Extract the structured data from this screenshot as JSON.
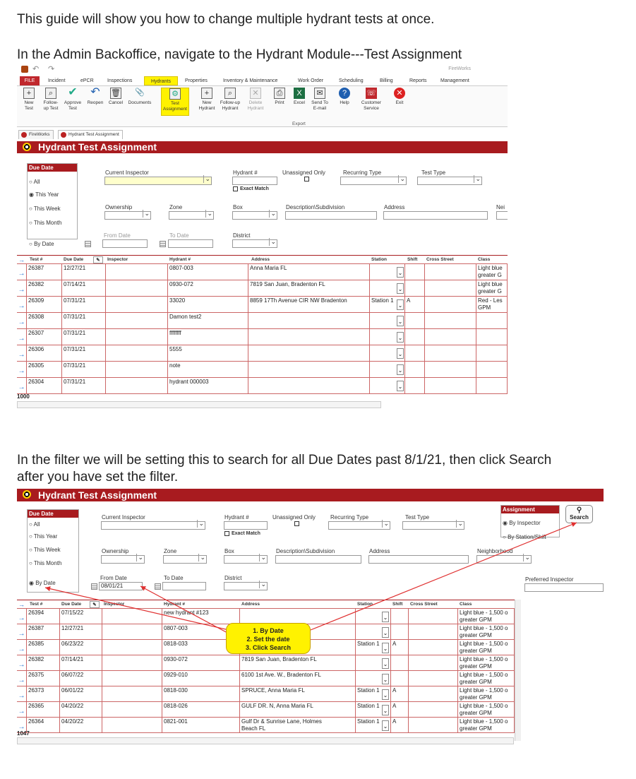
{
  "guide": {
    "intro": "This guide will show you how to change multiple hydrant tests at once.",
    "step1": "In the Admin Backoffice, navigate to the Hydrant Module---Test Assignment",
    "step2_line1": "In the filter we will be setting this to search for all Due Dates past 8/1/21, then click Search",
    "step2_line2": "after you have set the filter."
  },
  "app": {
    "brand": "FireWorks",
    "ribbon_tabs": [
      "FILE",
      "Incident",
      "ePCR",
      "Inspections",
      "Hydrants",
      "Properties",
      "Inventory & Maintenance",
      "Work Order",
      "Scheduling",
      "Billing",
      "Reports",
      "Management"
    ],
    "ribbon_buttons": {
      "new_test": "New\nTest",
      "followup_test": "Follow-\nup Test",
      "approve_test": "Approve\nTest",
      "reopen": "Reopen",
      "cancel": "Cancel",
      "documents": "Documents",
      "test_assignment": "Test\nAssignment",
      "new_hydrant": "New\nHydrant",
      "followup_hydrant": "Follow-up\nHydrant",
      "delete_hydrant": "Delete\nHydrant",
      "print": "Print",
      "excel": "Excel",
      "send_to_email": "Send To\nE-mail",
      "help": "Help",
      "customer_service": "Customer\nService",
      "exit": "Exit"
    },
    "export_group": "Export",
    "doc_tabs": [
      "FireWorks",
      "Hydrant Test Assignment"
    ],
    "window_title": "Hydrant Test Assignment"
  },
  "filters": {
    "due_date_title": "Due Date",
    "due_date_options": [
      "All",
      "This Year",
      "This Week",
      "This Month",
      "By Date"
    ],
    "current_inspector": "Current Inspector",
    "hydrant_num": "Hydrant #",
    "exact_match": "Exact Match",
    "unassigned_only": "Unassigned Only",
    "recurring_type": "Recurring Type",
    "test_type": "Test Type",
    "ownership": "Ownership",
    "zone": "Zone",
    "box": "Box",
    "description_subdivision": "Description\\Subdivision",
    "address": "Address",
    "neighborhood_cut": "Nei",
    "neighborhood": "Neighborhood",
    "from_date": "From Date",
    "to_date": "To Date",
    "district": "District",
    "from_date_value": "08/01/21",
    "assignment_title": "Assignment",
    "assignment_options": [
      "By Inspector",
      "By Station/Shift"
    ],
    "preferred_inspector": "Preferred Inspector",
    "search_label": "Search"
  },
  "grid_columns": [
    "Test #",
    "Due Date",
    "Inspector",
    "Hydrant #",
    "Address",
    "Station",
    "Shift",
    "Cross Street",
    "Class"
  ],
  "grid1": {
    "rows": [
      {
        "test": "26387",
        "due": "12/27/21",
        "hydrant": "0807-003",
        "address": "Anna Maria FL",
        "station": "",
        "shift": "",
        "class": "Light blue\ngreater G"
      },
      {
        "test": "26382",
        "due": "07/14/21",
        "hydrant": "0930-072",
        "address": "7819 San Juan, Bradenton FL",
        "station": "",
        "shift": "",
        "class": "Light blue\ngreater G"
      },
      {
        "test": "26309",
        "due": "07/31/21",
        "hydrant": "33020",
        "address": "8859 17Th Avenue CIR NW Bradenton",
        "station": "Station 1",
        "shift": "A",
        "class": "Red - Les\nGPM"
      },
      {
        "test": "26308",
        "due": "07/31/21",
        "hydrant": "Damon test2",
        "address": "",
        "station": "",
        "shift": "",
        "class": ""
      },
      {
        "test": "26307",
        "due": "07/31/21",
        "hydrant": "ffffffff",
        "address": "",
        "station": "",
        "shift": "",
        "class": ""
      },
      {
        "test": "26306",
        "due": "07/31/21",
        "hydrant": "5555",
        "address": "",
        "station": "",
        "shift": "",
        "class": ""
      },
      {
        "test": "26305",
        "due": "07/31/21",
        "hydrant": "note",
        "address": "",
        "station": "",
        "shift": "",
        "class": ""
      },
      {
        "test": "26304",
        "due": "07/31/21",
        "hydrant": "hydrant 000003",
        "address": "",
        "station": "",
        "shift": "",
        "class": ""
      }
    ],
    "count": "1000"
  },
  "grid2": {
    "rows": [
      {
        "test": "26394",
        "due": "07/15/22",
        "hydrant": "new hydrant #123",
        "address": "",
        "station": "",
        "shift": "",
        "class": "Light blue - 1,500 o\ngreater GPM"
      },
      {
        "test": "26387",
        "due": "12/27/21",
        "hydrant": "0807-003",
        "address": "",
        "station": "",
        "shift": "",
        "class": "Light blue - 1,500 o\ngreater GPM"
      },
      {
        "test": "26385",
        "due": "06/23/22",
        "hydrant": "0818-033",
        "address": "",
        "station": "Station 1",
        "shift": "A",
        "class": "Light blue - 1,500 o\ngreater GPM"
      },
      {
        "test": "26382",
        "due": "07/14/21",
        "hydrant": "0930-072",
        "address": "7819 San Juan, Bradenton FL",
        "station": "",
        "shift": "",
        "class": "Light blue - 1,500 o\ngreater GPM"
      },
      {
        "test": "26375",
        "due": "06/07/22",
        "hydrant": "0929-010",
        "address": "6100 1st Ave. W., Bradenton FL",
        "station": "",
        "shift": "",
        "class": "Light blue - 1,500 o\ngreater GPM"
      },
      {
        "test": "26373",
        "due": "06/01/22",
        "hydrant": "0818-030",
        "address": "SPRUCE, Anna Maria FL",
        "station": "Station 1",
        "shift": "A",
        "class": "Light blue - 1,500 o\ngreater GPM"
      },
      {
        "test": "26365",
        "due": "04/20/22",
        "hydrant": "0818-026",
        "address": "GULF DR. N, Anna Maria FL",
        "station": "Station 1",
        "shift": "A",
        "class": "Light blue - 1,500 o\ngreater GPM"
      },
      {
        "test": "26364",
        "due": "04/20/22",
        "hydrant": "0821-001",
        "address": "Gulf Dr & Sunrise Lane, Holmes\nBeach FL",
        "station": "Station 1",
        "shift": "A",
        "class": "Light blue - 1,500 o\ngreater GPM"
      }
    ],
    "count": "1047"
  },
  "callout": {
    "line1": "1. By Date",
    "line2": "2. Set the date",
    "line3": "3. Click Search"
  },
  "colors": {
    "accent": "#a81b1f",
    "highlight": "#fff200",
    "annotation": "#e03030"
  }
}
